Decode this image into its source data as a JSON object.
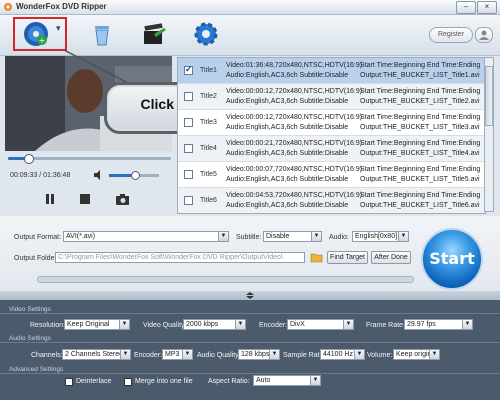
{
  "window": {
    "title": "WonderFox DVD Ripper",
    "minimize": "–",
    "close": "×"
  },
  "toolbar": {
    "register_label": "Register",
    "load_dvd_icon": "dvd-disc-icon",
    "dropdown_arrow": "▾",
    "delete_icon": "trash-icon",
    "edit_icon": "clapperboard-icon",
    "settings_icon": "gear-icon"
  },
  "callout": {
    "text": "Click here"
  },
  "player": {
    "time": "00:09:33 / 01:36:48",
    "seek_fraction": 0.12,
    "volume_fraction": 0.5
  },
  "titles": [
    {
      "name": "Title1",
      "checked": true,
      "l1": "Video:01:36:48,720x480,NTSC,HDTV(16:9)",
      "l2": "Audio:English,AC3,6ch Subtitle:Disable",
      "r1": "Start Time:Beginning End Time:Ending",
      "r2": "Output:THE_BUCKET_LIST_Title1.avi"
    },
    {
      "name": "Title2",
      "checked": false,
      "l1": "Video:00:00:12,720x480,NTSC,HDTV(16:9)",
      "l2": "Audio:English,AC3,6ch Subtitle:Disable",
      "r1": "Start Time:Beginning End Time:Ending",
      "r2": "Output:THE_BUCKET_LIST_Title2.avi"
    },
    {
      "name": "Title3",
      "checked": false,
      "l1": "Video:00:00:12,720x480,NTSC,HDTV(16:9)",
      "l2": "Audio:English,AC3,6ch Subtitle:Disable",
      "r1": "Start Time:Beginning End Time:Ending",
      "r2": "Output:THE_BUCKET_LIST_Title3.avi"
    },
    {
      "name": "Title4",
      "checked": false,
      "l1": "Video:00:00:21,720x480,NTSC,HDTV(16:9)",
      "l2": "Audio:English,AC3,6ch Subtitle:Disable",
      "r1": "Start Time:Beginning End Time:Ending",
      "r2": "Output:THE_BUCKET_LIST_Title4.avi"
    },
    {
      "name": "Title5",
      "checked": false,
      "l1": "Video:00:00:07,720x480,NTSC,HDTV(16:9)",
      "l2": "Audio:English,AC3,6ch Subtitle:Disable",
      "r1": "Start Time:Beginning End Time:Ending",
      "r2": "Output:THE_BUCKET_LIST_Title5.avi"
    },
    {
      "name": "Title6",
      "checked": false,
      "l1": "Video:00:04:53,720x480,NTSC,HDTV(16:9)",
      "l2": "Audio:English,AC3,6ch Subtitle:Disable",
      "r1": "Start Time:Beginning End Time:Ending",
      "r2": "Output:THE_BUCKET_LIST_Title6.avi"
    }
  ],
  "output": {
    "format_label": "Output Format:",
    "format_value": "AVI(*.avi)",
    "subtitle_label": "Subtitle:",
    "subtitle_value": "Disable",
    "audio_label": "Audio:",
    "audio_value": "English[0x80]",
    "folder_label": "Output Folder",
    "folder_value": "C:\\Program Files\\WonderFox Soft\\WonderFox DVD Ripper\\OutputVideo\\",
    "find_target": "Find Target",
    "after_done": "After Done",
    "start": "Start"
  },
  "video_settings": {
    "section": "Video Settings",
    "resolution_label": "Resolution:",
    "resolution_value": "Keep Original",
    "quality_label": "Video Quality:",
    "quality_value": "2000 kbps",
    "encoder_label": "Encoder:",
    "encoder_value": "DivX",
    "framerate_label": "Frame Rate:",
    "framerate_value": "29.97 fps"
  },
  "audio_settings": {
    "section": "Audio Settings",
    "channels_label": "Channels:",
    "channels_value": "2 Channels Stereo",
    "encoder_label": "Encoder:",
    "encoder_value": "MP3",
    "quality_label": "Audio Quality:",
    "quality_value": "128 kbps",
    "samplerate_label": "Sample Rate:",
    "samplerate_value": "44100 Hz",
    "volume_label": "Volume:",
    "volume_value": "Keep origina"
  },
  "advanced_settings": {
    "section": "Advanced Settings",
    "deinterlace_label": "Deinterlace",
    "merge_label": "Merge into one file",
    "aspect_label": "Aspect Ratio:",
    "aspect_value": "Auto"
  },
  "colors": {
    "accent": "#2a6fc2",
    "highlight_box": "#d3272a",
    "settings_bg": "#4c5b6c"
  }
}
